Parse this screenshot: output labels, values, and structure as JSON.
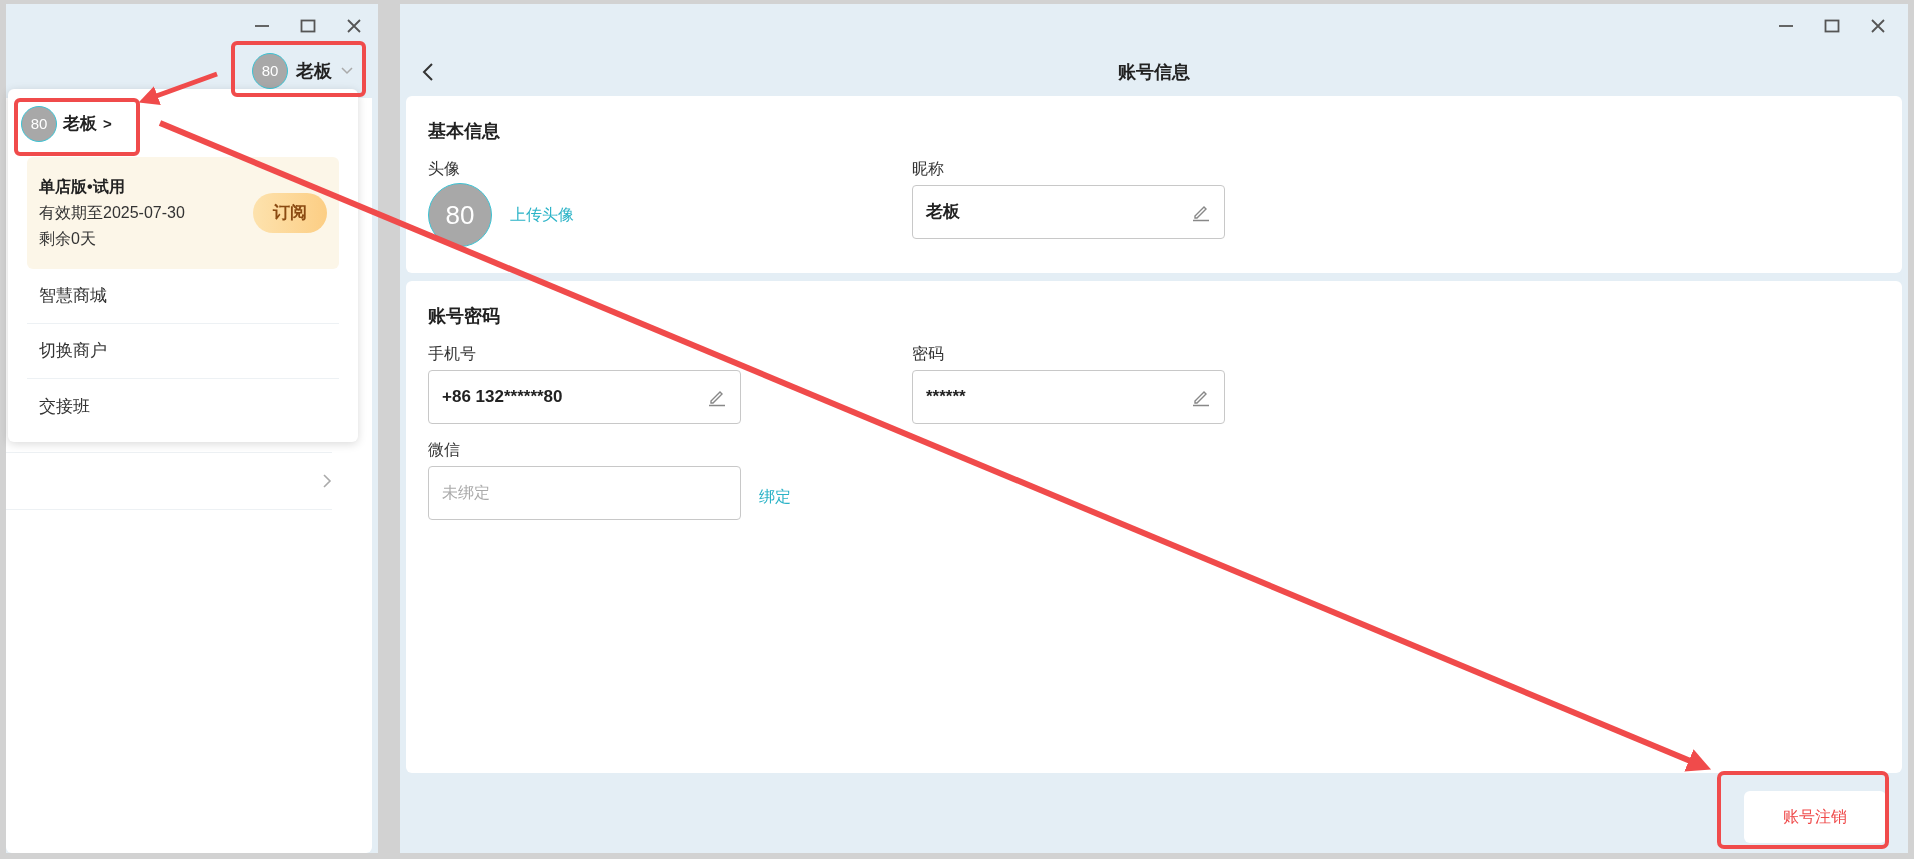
{
  "left_window": {
    "user_chip": {
      "avatar": "80",
      "name": "老板"
    },
    "dropdown": {
      "user": {
        "avatar": "80",
        "name": "老板",
        "chevron": ">"
      },
      "subscription": {
        "plan": "单店版•试用",
        "expiry": "有效期至2025-07-30",
        "remaining": "剩余0天",
        "button": "订阅"
      },
      "items": [
        "智慧商城",
        "切换商户",
        "交接班"
      ]
    }
  },
  "account_page": {
    "title": "账号信息",
    "sections": [
      {
        "title": "基本信息",
        "fields": [
          {
            "kind": "avatar",
            "label": "头像",
            "avatar": "80",
            "action": "上传头像"
          },
          {
            "kind": "input",
            "label": "昵称",
            "value": "老板",
            "editable": true
          }
        ]
      },
      {
        "title": "账号密码",
        "fields": [
          {
            "kind": "input",
            "label": "手机号",
            "value": "+86 132******80",
            "editable": true
          },
          {
            "kind": "input",
            "label": "密码",
            "value": "******",
            "editable": true
          },
          {
            "kind": "input",
            "label": "微信",
            "placeholder": "未绑定",
            "action": "绑定",
            "editable": false
          }
        ]
      }
    ],
    "footer_button": "账号注销"
  }
}
